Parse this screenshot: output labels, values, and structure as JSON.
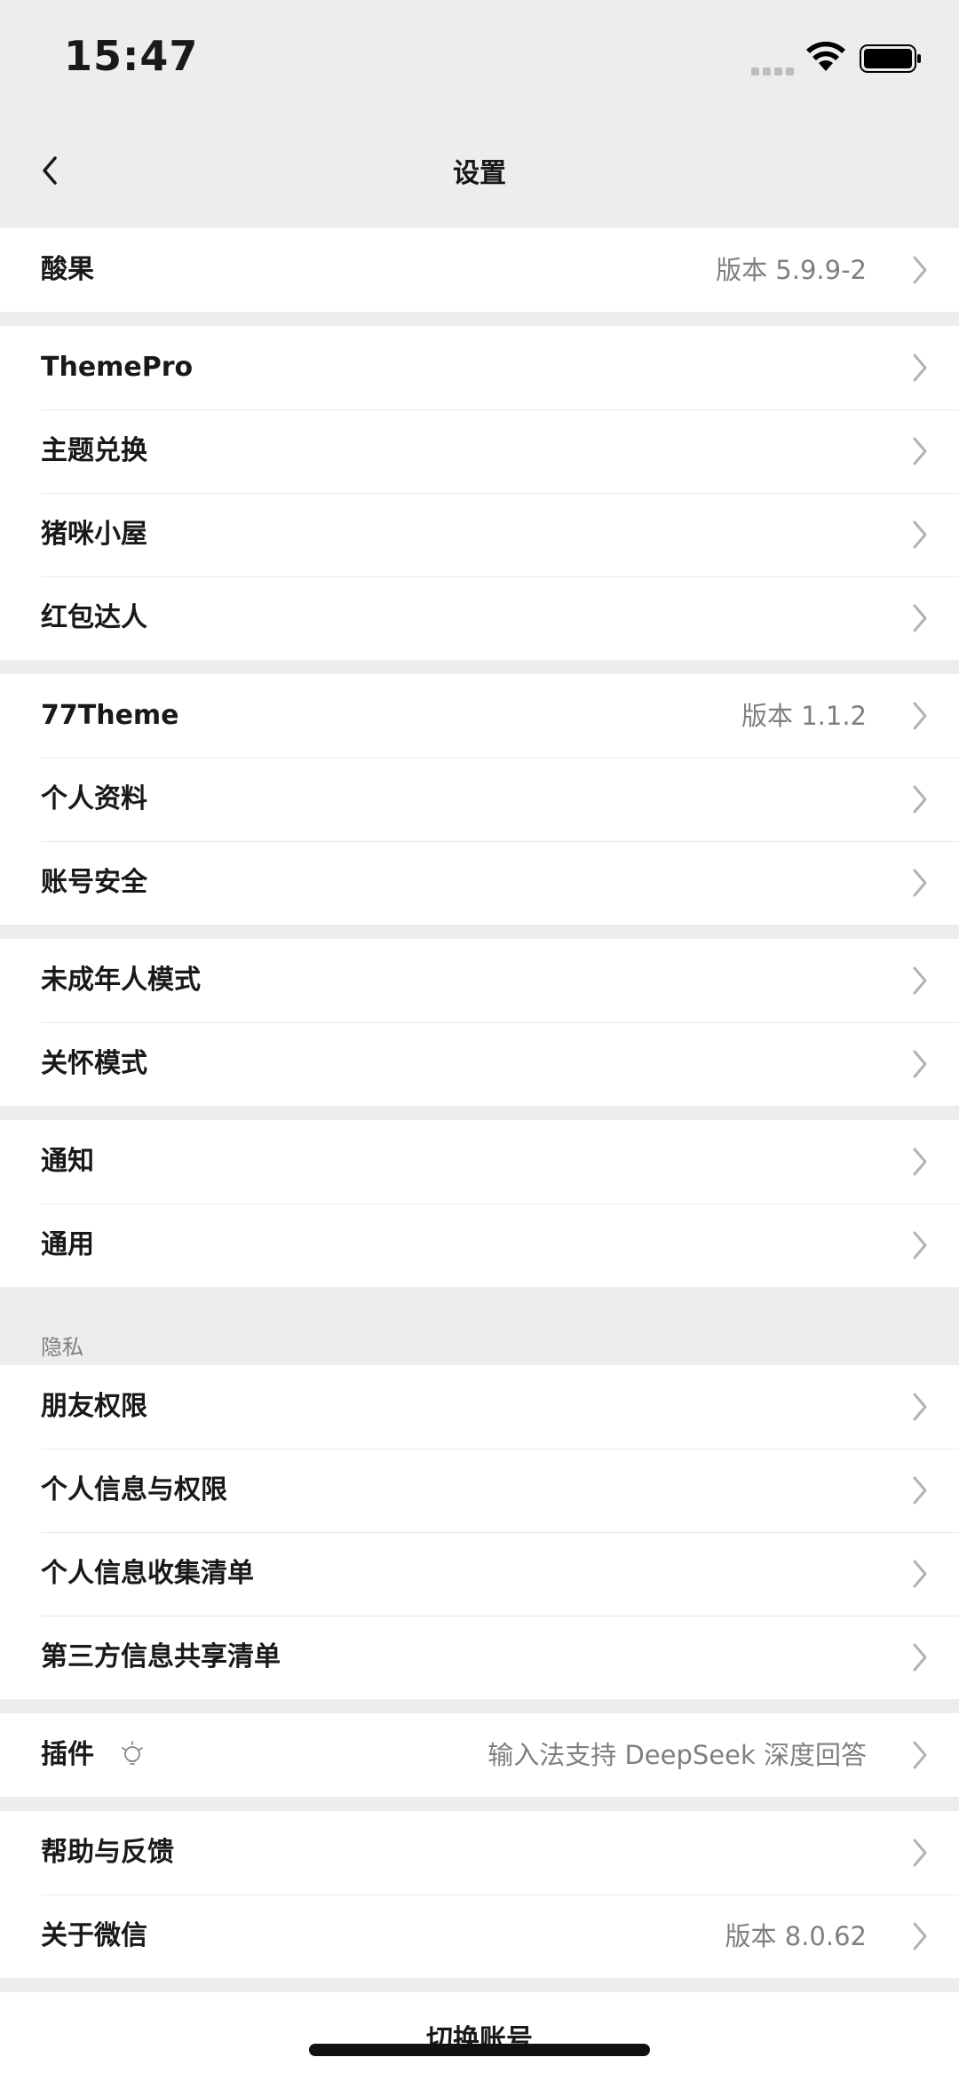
{
  "status_bar": {
    "time": "15:47"
  },
  "header": {
    "title": "设置"
  },
  "sections": [
    {
      "rows": [
        {
          "label": "酸果",
          "value": "版本 5.9.9-2"
        }
      ]
    },
    {
      "rows": [
        {
          "label": "ThemePro",
          "value": ""
        },
        {
          "label": "主题兑换",
          "value": ""
        },
        {
          "label": "猪咪小屋",
          "value": ""
        },
        {
          "label": "红包达人",
          "value": ""
        }
      ]
    },
    {
      "rows": [
        {
          "label": "77Theme",
          "value": "版本 1.1.2"
        },
        {
          "label": "个人资料",
          "value": ""
        },
        {
          "label": "账号安全",
          "value": ""
        }
      ]
    },
    {
      "rows": [
        {
          "label": "未成年人模式",
          "value": ""
        },
        {
          "label": "关怀模式",
          "value": ""
        }
      ]
    },
    {
      "rows": [
        {
          "label": "通知",
          "value": ""
        },
        {
          "label": "通用",
          "value": ""
        }
      ]
    }
  ],
  "privacy": {
    "header": "隐私",
    "rows": [
      {
        "label": "朋友权限"
      },
      {
        "label": "个人信息与权限"
      },
      {
        "label": "个人信息收集清单"
      },
      {
        "label": "第三方信息共享清单"
      }
    ]
  },
  "plugins": {
    "label": "插件",
    "value": "输入法支持 DeepSeek 深度回答"
  },
  "help_section": {
    "rows": [
      {
        "label": "帮助与反馈",
        "value": ""
      },
      {
        "label": "关于微信",
        "value": "版本 8.0.62"
      }
    ]
  },
  "bottom": {
    "switch_account": "切换账号"
  }
}
